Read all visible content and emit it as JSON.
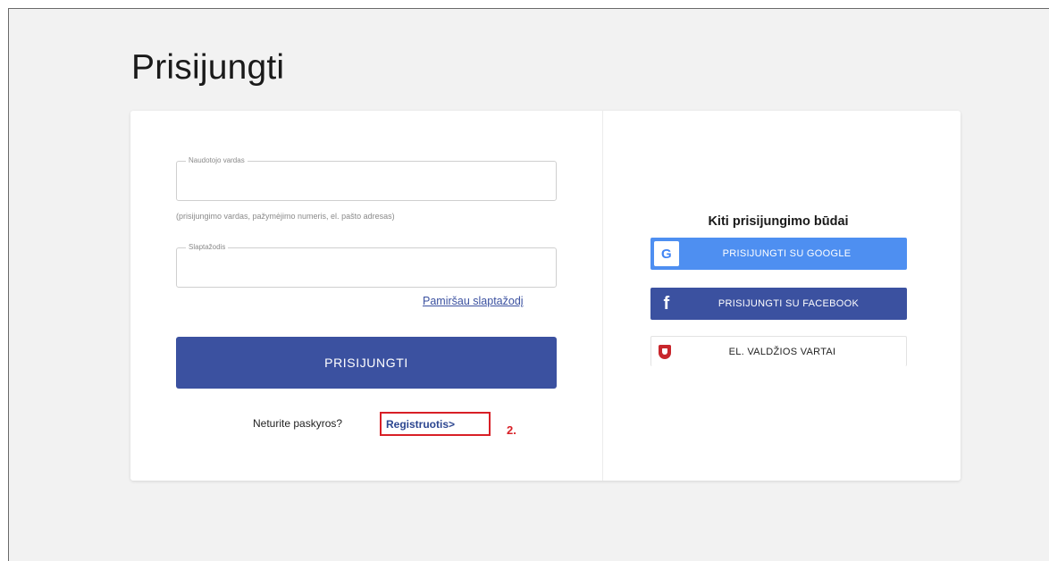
{
  "page": {
    "title": "Prisijungti"
  },
  "login_form": {
    "username_label": "Naudotojo vardas",
    "username_value": "",
    "username_hint": "(prisijungimo vardas, pažymėjimo numeris, el. pašto adresas)",
    "password_label": "Slaptažodis",
    "password_value": "",
    "forgot_password": "Pamiršau slaptažodį",
    "submit_label": "PRISIJUNGTI",
    "register_prompt": "Neturite paskyros?",
    "register_link": "Registruotis>",
    "step_marker": "2."
  },
  "other_methods": {
    "title": "Kiti prisijungimo būdai",
    "google_label": "PRISIJUNGTI SU GOOGLE",
    "google_icon_letter": "G",
    "facebook_label": "PRISIJUNGTI SU FACEBOOK",
    "facebook_icon_letter": "f",
    "gov_label": "EL. VALDŽIOS VARTAI"
  },
  "icons": {
    "google": "google-icon",
    "facebook": "facebook-icon",
    "gov": "coat-of-arms-icon"
  },
  "colors": {
    "primary": "#3b51a0",
    "google": "#4e8ff1",
    "highlight": "#d81f26",
    "background": "#f2f2f2"
  }
}
